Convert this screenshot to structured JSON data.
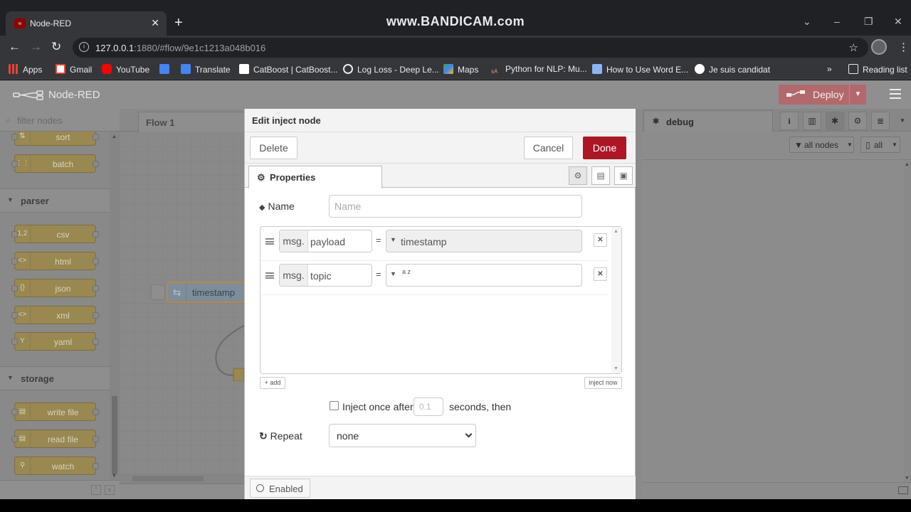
{
  "browser": {
    "tab_title": "Node-RED",
    "tab_favicon": "node-red-favicon",
    "new_tab_label": "+",
    "watermark": "www.BANDICAM.com",
    "url_host": "127.0.0.1",
    "url_path": ":1880/#flow/9e1c1213a048b016",
    "bookmarks": [
      {
        "label": "Apps",
        "icon": "apps-grid-icon",
        "color": "#ea4335"
      },
      {
        "label": "Gmail",
        "icon": "gmail-icon",
        "color": "#ea4335"
      },
      {
        "label": "YouTube",
        "icon": "youtube-icon",
        "color": "#ff0000"
      },
      {
        "label": "",
        "icon": "docs-icon",
        "color": "#4285f4"
      },
      {
        "label": "Translate",
        "icon": "translate-icon",
        "color": "#4285f4"
      },
      {
        "label": "CatBoost | CatBoost...",
        "icon": "catboost-icon",
        "color": "#ffffff"
      },
      {
        "label": "Log Loss - Deep Le...",
        "icon": "globe-icon",
        "color": "#e8eaed"
      },
      {
        "label": "Maps",
        "icon": "maps-icon",
        "color": "#34a853"
      },
      {
        "label": "Python for NLP: Mu...",
        "icon": "stackabuse-icon",
        "color": "#f28b82"
      },
      {
        "label": "How to Use Word E...",
        "icon": "mlm-icon",
        "color": "#8ab4f8"
      },
      {
        "label": "Je suis candidat",
        "icon": "candidat-icon",
        "color": "#ffffff"
      }
    ],
    "reading_list": "Reading list"
  },
  "nodered": {
    "title": "Node-RED",
    "deploy_label": "Deploy"
  },
  "palette": {
    "filter_placeholder": "filter nodes",
    "sequence_nodes": [
      "sort",
      "batch"
    ],
    "categories": [
      {
        "label": "parser",
        "nodes": [
          "csv",
          "html",
          "json",
          "xml",
          "yaml"
        ]
      },
      {
        "label": "storage",
        "nodes": [
          "write file",
          "read file",
          "watch"
        ]
      }
    ]
  },
  "workspace": {
    "tab_label": "Flow 1",
    "node_label": "timestamp"
  },
  "tray": {
    "title": "Edit inject node",
    "delete_label": "Delete",
    "cancel_label": "Cancel",
    "done_label": "Done",
    "properties_tab": "Properties",
    "name_label": "Name",
    "name_placeholder": "Name",
    "rows": [
      {
        "prefix": "msg.",
        "field": "payload",
        "type_value": "timestamp"
      },
      {
        "prefix": "msg.",
        "field": "topic",
        "type_value": ""
      }
    ],
    "equals": "=",
    "az_glyph": "a z",
    "add_label": "add",
    "inject_now_label": "inject now",
    "inject_once_label": "Inject once after",
    "inject_once_seconds": "0.1",
    "seconds_then": "seconds, then",
    "repeat_label": "Repeat",
    "repeat_value": "none",
    "enabled_label": "Enabled"
  },
  "sidebar": {
    "tab_label": "debug",
    "filter_nodes_label": "all nodes",
    "clear_label": "all"
  }
}
